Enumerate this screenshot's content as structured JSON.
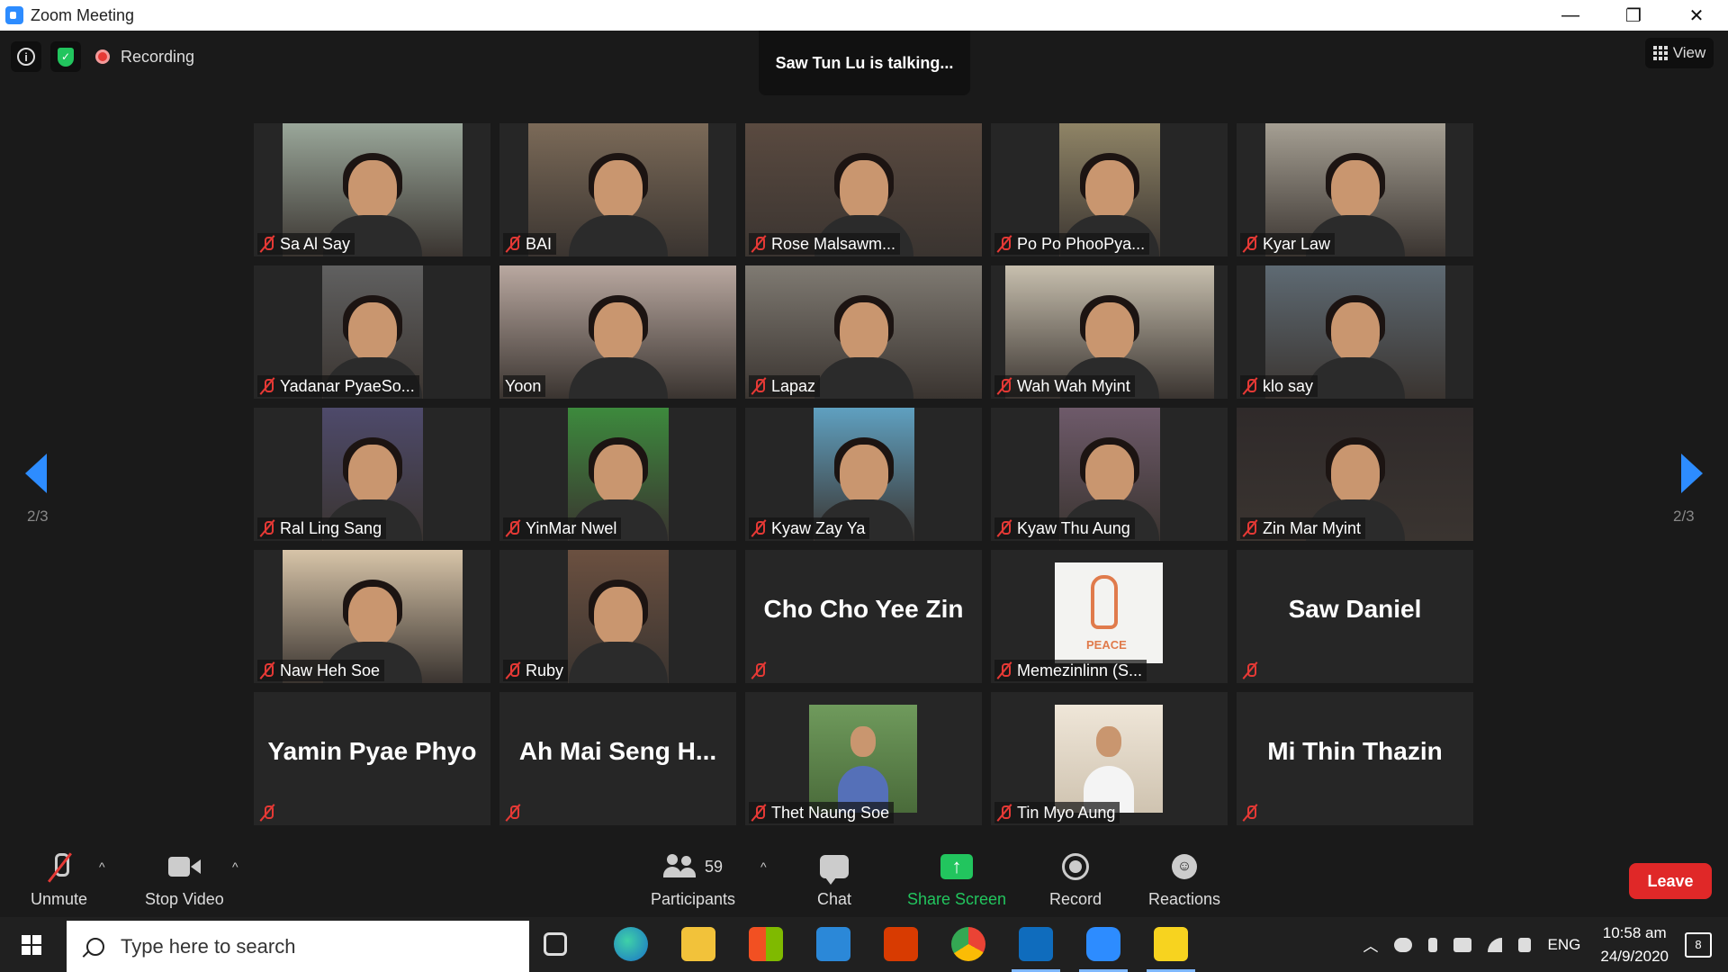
{
  "window": {
    "title": "Zoom Meeting",
    "minimize": "—",
    "restore": "❐",
    "close": "✕"
  },
  "header": {
    "recording_label": "Recording",
    "talking_text": "Saw Tun Lu is talking...",
    "view_label": "View"
  },
  "pagination": {
    "left": "2/3",
    "right": "2/3"
  },
  "participants": [
    {
      "name": "Sa Al Say",
      "video": true,
      "muted": true
    },
    {
      "name": "BAI",
      "video": true,
      "muted": true
    },
    {
      "name": "Rose Malsawm...",
      "video": true,
      "muted": true
    },
    {
      "name": "Po Po PhooPya...",
      "video": true,
      "muted": true
    },
    {
      "name": "Kyar Law",
      "video": true,
      "muted": true
    },
    {
      "name": "Yadanar PyaeSo...",
      "video": true,
      "muted": true
    },
    {
      "name": "Yoon",
      "video": true,
      "muted": false
    },
    {
      "name": "Lapaz",
      "video": true,
      "muted": true
    },
    {
      "name": "Wah Wah Myint",
      "video": true,
      "muted": true
    },
    {
      "name": "klo say",
      "video": true,
      "muted": true
    },
    {
      "name": "Ral Ling Sang",
      "video": true,
      "muted": true
    },
    {
      "name": "YinMar Nwel",
      "video": true,
      "muted": true
    },
    {
      "name": "Kyaw Zay Ya",
      "video": true,
      "muted": true
    },
    {
      "name": "Kyaw Thu Aung",
      "video": true,
      "muted": true
    },
    {
      "name": "Zin Mar Myint",
      "video": true,
      "muted": true
    },
    {
      "name": "Naw Heh Soe",
      "video": true,
      "muted": true
    },
    {
      "name": "Ruby",
      "video": true,
      "muted": true
    },
    {
      "name": "Cho Cho Yee Zin",
      "video": false,
      "muted": true
    },
    {
      "name": "Memezinlinn (S...",
      "video": false,
      "avatar": "peace-image",
      "muted": true
    },
    {
      "name": "Saw Daniel",
      "video": false,
      "muted": true
    },
    {
      "name": "Yamin Pyae Phyo",
      "video": false,
      "muted": true
    },
    {
      "name": "Ah Mai Seng H...",
      "video": false,
      "muted": true
    },
    {
      "name": "Thet Naung Soe",
      "video": false,
      "avatar": "photo",
      "muted": true
    },
    {
      "name": "Tin Myo Aung",
      "video": false,
      "avatar": "photo",
      "muted": true
    },
    {
      "name": "Mi Thin Thazin",
      "video": false,
      "muted": true
    }
  ],
  "peace_text": "PEACE",
  "toolbar": {
    "unmute": "Unmute",
    "stop_video": "Stop Video",
    "participants": "Participants",
    "participant_count": "59",
    "chat": "Chat",
    "share_screen": "Share Screen",
    "record": "Record",
    "reactions": "Reactions",
    "leave": "Leave",
    "caret": "^"
  },
  "taskbar": {
    "search_placeholder": "Type here to search",
    "language": "ENG",
    "time": "10:58 am",
    "date": "24/9/2020",
    "notification_count": "8"
  },
  "colors": {
    "accent": "#2d8cff",
    "share_green": "#22c55e",
    "leave_red": "#e02828",
    "muted_red": "#e53935"
  }
}
